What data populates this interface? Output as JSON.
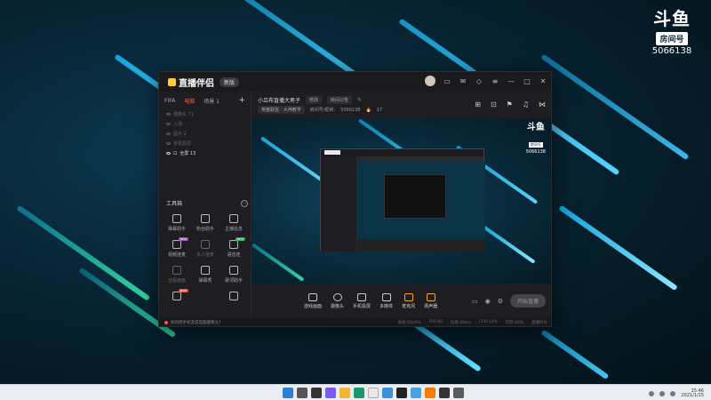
{
  "watermark": {
    "logo": "斗鱼",
    "tag": "房间号",
    "room_number": "5066138"
  },
  "app": {
    "name": "直播伴侣",
    "version_label": "新版",
    "sidebar": {
      "tabs": [
        "FIFA",
        "电脑",
        "场景 1"
      ],
      "active_tab": 1,
      "add_label": "+",
      "scenes": [
        {
          "label": "摄像头 71",
          "active": false
        },
        {
          "label": "入场",
          "active": false
        },
        {
          "label": "图片 2",
          "active": false
        },
        {
          "label": "手机投屏",
          "active": false
        },
        {
          "label": "全屏 13",
          "active": true
        }
      ],
      "toolbox_title": "工具箱",
      "toolbox_more": "···",
      "tools": [
        {
          "label": "弹幕助手",
          "badge": "",
          "dim": false
        },
        {
          "label": "粉丝助手",
          "badge": "",
          "dim": false
        },
        {
          "label": "主播信息",
          "badge": "",
          "dim": false
        },
        {
          "label": "视频连麦",
          "badge": "NEW",
          "badge_color": "#9b59b6",
          "dim": false
        },
        {
          "label": "多人连麦",
          "badge": "",
          "dim": true
        },
        {
          "label": "语音连",
          "badge": "NEW",
          "badge_color": "#27ae60",
          "dim": false
        },
        {
          "label": "远程画面",
          "badge": "",
          "dim": true
        },
        {
          "label": "弹幕秀",
          "badge": "",
          "dim": false
        },
        {
          "label": "歌词助手",
          "badge": "",
          "dim": false
        },
        {
          "label": "抽奖",
          "badge": "NEW",
          "badge_color": "#e74c3c",
          "dim": false
        },
        {
          "label": "",
          "badge": "",
          "dim": false
        },
        {
          "label": "",
          "badge": "",
          "dim": false
        }
      ]
    },
    "room": {
      "title": "小吕布直播大男子",
      "category_chip": "修改",
      "notice_chip": "房间公告",
      "tag_chip": "英雄联盟 · 大神教学",
      "room_id_label": "房间号/昵称:",
      "room_id": "5066138",
      "fans_count": "17"
    },
    "controls": [
      "游戏画面",
      "摄像头",
      "手机投屏",
      "多媒体",
      "麦克风",
      "扬声器"
    ],
    "start_button": "开始直播",
    "status_tip": "如何把手机变成电脑摄像头?",
    "stats": [
      "丢帧:0%/0%",
      "FPS:60",
      "码率:0kb/s",
      "CPU:14%",
      "内存:48%",
      "直播时长"
    ]
  },
  "taskbar": {
    "time": "15:46",
    "date": "2021/1/15"
  }
}
